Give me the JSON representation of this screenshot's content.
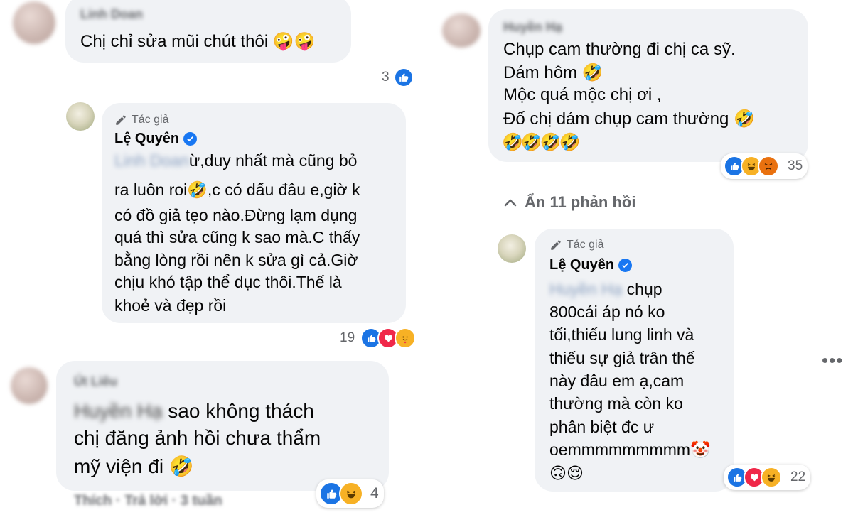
{
  "left": {
    "c1": {
      "name": "Linh Doan",
      "text": "Chị chỉ sửa mũi chút thôi 🤪🤪",
      "likes": "3"
    },
    "r1": {
      "badge": "Tác giả",
      "name": "Lệ Quyên",
      "mention": "Linh Doan",
      "lines": [
        "ừ,duy nhất mà cũng bỏ",
        "ra luôn roi🤣,c có dấu đâu e,giờ k",
        "có đồ giả tẹo nào.Đừng lạm dụng",
        "quá thì sửa cũng k sao mà.C thấy",
        "bằng lòng rồi nên k sửa gì cả.Giờ",
        "chịu khó tập thể dục thôi.Thế là",
        "khoẻ và đẹp rồi"
      ],
      "reactions": "19"
    },
    "c2": {
      "name": "Út Liêu",
      "mention": "Huyền Hạ",
      "lines": [
        " sao không thách",
        "chị đăng ảnh hồi chưa thẩm",
        "mỹ viện đi 🤣"
      ],
      "reactions": "4",
      "actions": "Thích · Trả lời · 3 tuần"
    }
  },
  "right": {
    "c3": {
      "name": "Huyền Hạ",
      "lines": [
        "Chụp cam thường đi chị ca sỹ.",
        "Dám hôm 🤣",
        "Mộc quá mộc chị ơi ,",
        "Đố chị dám chụp cam thường 🤣",
        "🤣🤣🤣🤣"
      ],
      "reactions": "35"
    },
    "toggle": "Ẩn 11 phản hồi",
    "r2": {
      "badge": "Tác giả",
      "name": "Lệ Quyên",
      "mention": "Huyền Hạ",
      "lines": [
        " chụp",
        "800cái áp nó ko",
        "tối,thiếu lung linh và",
        "thiếu sự giả trân thế",
        "này đâu em ạ,cam",
        "thường mà còn ko",
        "phân biệt đc ư",
        "oemmmmmmmmm🤡",
        "🙃😌"
      ],
      "reactions": "22"
    },
    "more": "•••"
  },
  "colors": {
    "bubble": "#f0f2f5",
    "like": "#1b74e4",
    "love": "#f02849",
    "haha": "#f7b125",
    "angry": "#e9710f",
    "meta": "#65676b"
  }
}
